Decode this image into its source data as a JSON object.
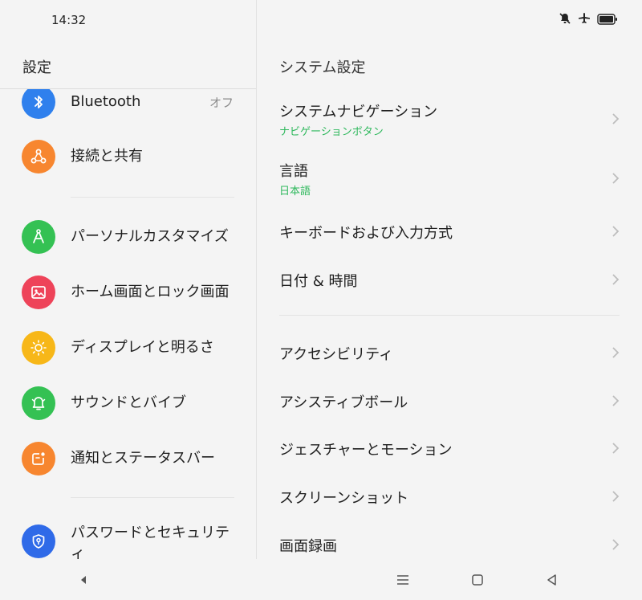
{
  "status": {
    "time": "14:32"
  },
  "left": {
    "title": "設定",
    "items": [
      {
        "label": "Bluetooth",
        "value": "オフ",
        "icon": "bluetooth-icon",
        "color": "#2f80ed"
      },
      {
        "label": "接続と共有",
        "icon": "share-icon",
        "color": "#f7862f"
      },
      {
        "label": "パーソナルカスタマイズ",
        "icon": "compass-icon",
        "color": "#34c153"
      },
      {
        "label": "ホーム画面とロック画面",
        "icon": "image-icon",
        "color": "#ee4359"
      },
      {
        "label": "ディスプレイと明るさ",
        "icon": "sun-icon",
        "color": "#f7b718"
      },
      {
        "label": "サウンドとバイブ",
        "icon": "bell-icon",
        "color": "#34c153"
      },
      {
        "label": "通知とステータスバー",
        "icon": "notification-icon",
        "color": "#f7862f"
      },
      {
        "label": "パスワードとセキュリティ",
        "icon": "shield-icon",
        "color": "#2f6ae8"
      }
    ]
  },
  "right": {
    "title": "システム設定",
    "items": [
      {
        "label": "システムナビゲーション",
        "sub": "ナビゲーションボタン"
      },
      {
        "label": "言語",
        "sub": "日本語"
      },
      {
        "label": "キーボードおよび入力方式"
      },
      {
        "label": "日付 & 時間"
      },
      {
        "label": "アクセシビリティ"
      },
      {
        "label": "アシスティブボール"
      },
      {
        "label": "ジェスチャーとモーション"
      },
      {
        "label": "スクリーンショット"
      },
      {
        "label": "画面録画"
      }
    ]
  },
  "nav": {
    "icons": [
      "back-small-icon",
      "menu-icon",
      "home-icon",
      "back-icon"
    ]
  }
}
